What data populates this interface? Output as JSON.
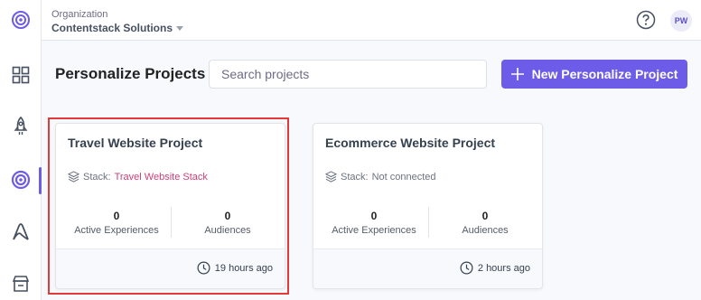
{
  "header": {
    "org_label": "Organization",
    "org_name": "Contentstack Solutions",
    "avatar_initials": "PW"
  },
  "sidebar": {
    "items": [
      {
        "icon": "target-logo-icon"
      },
      {
        "icon": "dashboard-grid-icon"
      },
      {
        "icon": "rocket-icon"
      },
      {
        "icon": "personalize-target-icon",
        "active": true
      },
      {
        "icon": "automate-icon"
      },
      {
        "icon": "marketplace-icon"
      }
    ]
  },
  "page": {
    "title": "Personalize Projects",
    "search_placeholder": "Search projects",
    "new_button_label": "New Personalize Project",
    "accent_color": "#6c5ce7"
  },
  "projects": [
    {
      "name": "Travel Website Project",
      "stack_label": "Stack:",
      "stack_value": "Travel Website Stack",
      "stack_linked": true,
      "experiences_count": "0",
      "experiences_label": "Active Experiences",
      "audiences_count": "0",
      "audiences_label": "Audiences",
      "updated": "19 hours ago",
      "highlighted": true
    },
    {
      "name": "Ecommerce Website Project",
      "stack_label": "Stack:",
      "stack_value": "Not connected",
      "stack_linked": false,
      "experiences_count": "0",
      "experiences_label": "Active Experiences",
      "audiences_count": "0",
      "audiences_label": "Audiences",
      "updated": "2 hours ago",
      "highlighted": false
    }
  ]
}
